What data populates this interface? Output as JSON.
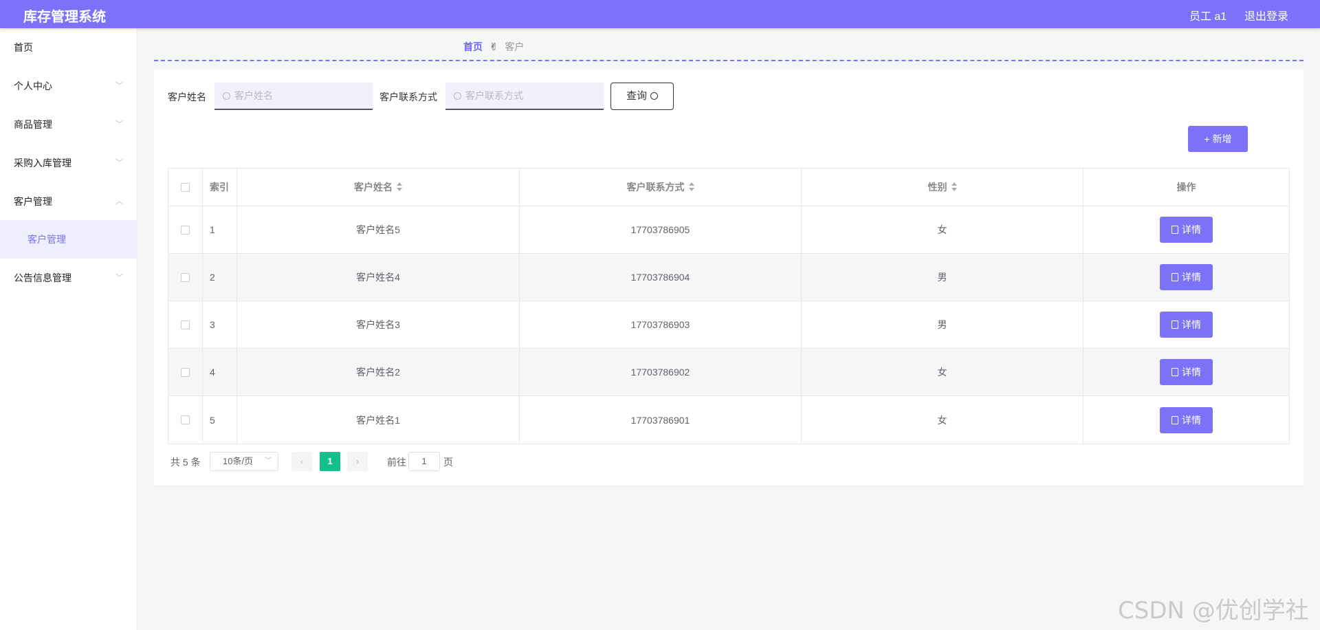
{
  "header": {
    "app_title": "库存管理系统",
    "user": "员工 a1",
    "logout": "退出登录"
  },
  "sidebar": {
    "items": [
      {
        "label": "首页"
      },
      {
        "label": "个人中心"
      },
      {
        "label": "商品管理"
      },
      {
        "label": "采购入库管理"
      },
      {
        "label": "客户管理"
      },
      {
        "label": "客户管理"
      },
      {
        "label": "公告信息管理"
      }
    ]
  },
  "breadcrumb": {
    "home": "首页",
    "separator": "✌",
    "current": "客户"
  },
  "search": {
    "name_label": "客户姓名",
    "name_placeholder": "客户姓名",
    "contact_label": "客户联系方式",
    "contact_placeholder": "客户联系方式",
    "query_label": "查询"
  },
  "actions": {
    "add_label": "+ 新增"
  },
  "table": {
    "headers": [
      "索引",
      "客户姓名",
      "客户联系方式",
      "性别",
      "操作"
    ],
    "rows": [
      {
        "index": "1",
        "name": "客户姓名5",
        "contact": "17703786905",
        "gender": "女",
        "action": "详情"
      },
      {
        "index": "2",
        "name": "客户姓名4",
        "contact": "17703786904",
        "gender": "男",
        "action": "详情"
      },
      {
        "index": "3",
        "name": "客户姓名3",
        "contact": "17703786903",
        "gender": "男",
        "action": "详情"
      },
      {
        "index": "4",
        "name": "客户姓名2",
        "contact": "17703786902",
        "gender": "女",
        "action": "详情"
      },
      {
        "index": "5",
        "name": "客户姓名1",
        "contact": "17703786901",
        "gender": "女",
        "action": "详情"
      }
    ]
  },
  "pagination": {
    "total": "共 5 条",
    "page_size": "10条/页",
    "prev": "‹",
    "current_page": "1",
    "next": "›",
    "goto_prefix": "前往",
    "goto_value": "1",
    "goto_suffix": "页"
  },
  "watermark": "CSDN @优创学社",
  "colors": {
    "primary": "#7b72f7",
    "active_page": "#13c08d"
  }
}
